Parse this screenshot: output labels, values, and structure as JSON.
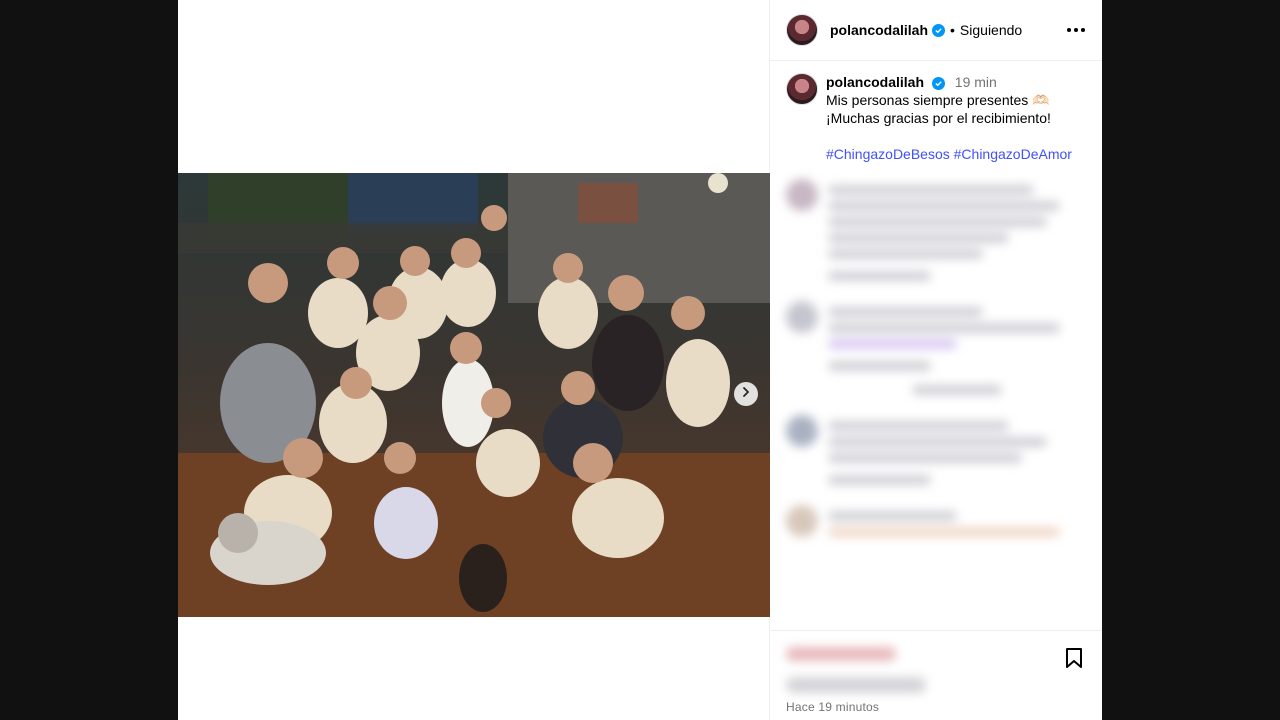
{
  "post": {
    "username": "polancodalilah",
    "follow_status": "Siguiendo",
    "caption_time": "19 min",
    "caption_line1": "Mis personas siempre presentes 🫶🏻",
    "caption_line2": "¡Muchas gracias por el recibimiento!",
    "hashtag1": "#ChingazoDeBesos",
    "hashtag2": "#ChingazoDeAmor",
    "posted_ago": "Hace 19 minutos"
  },
  "icons": {
    "verified": "verified-badge-icon",
    "more": "more-options-icon",
    "next": "chevron-right-icon",
    "save": "bookmark-icon"
  },
  "colors": {
    "verified": "#0095f6",
    "hashtag": "#4150f7",
    "muted": "#737373",
    "backdrop": "#111111"
  }
}
